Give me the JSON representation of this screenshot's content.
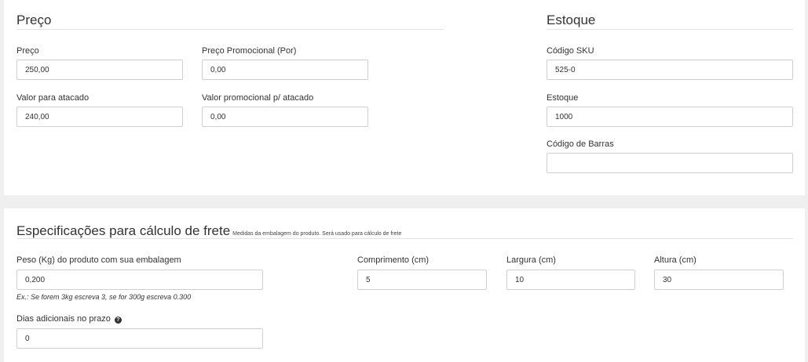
{
  "preco": {
    "title": "Preço",
    "preco_label": "Preço",
    "preco_value": "250,00",
    "promo_label": "Preço Promocional (Por)",
    "promo_value": "0,00",
    "atacado_label": "Valor para atacado",
    "atacado_value": "240,00",
    "promo_atacado_label": "Valor promocional p/ atacado",
    "promo_atacado_value": "0,00"
  },
  "estoque": {
    "title": "Estoque",
    "sku_label": "Código SKU",
    "sku_value": "525-0",
    "estoque_label": "Estoque",
    "estoque_value": "1000",
    "barras_label": "Código de Barras",
    "barras_value": ""
  },
  "frete": {
    "title": "Especificações para cálculo de frete",
    "note": "Medidas da embalagem do produto. Será usado para cálculo de frete",
    "peso_label": "Peso (Kg) do produto com sua embalagem",
    "peso_value": "0,200",
    "peso_hint": "Ex.: Se forem 3kg escreva 3, se for 300g escreva 0.300",
    "comprimento_label": "Comprimento (cm)",
    "comprimento_value": "5",
    "largura_label": "Largura (cm)",
    "largura_value": "10",
    "altura_label": "Altura (cm)",
    "altura_value": "30",
    "dias_label": "Dias adicionais no prazo",
    "dias_value": "0",
    "help_icon": "question-circle-icon"
  }
}
